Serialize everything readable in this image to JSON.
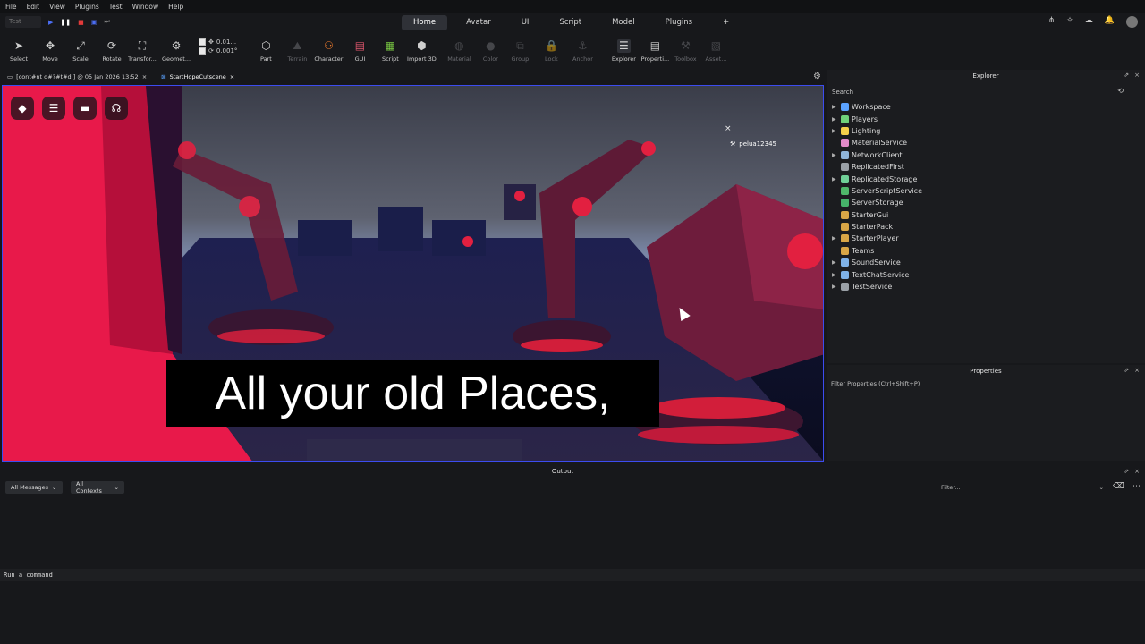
{
  "menu": [
    "File",
    "Edit",
    "View",
    "Plugins",
    "Test",
    "Window",
    "Help"
  ],
  "test_mode": "Test",
  "top_tabs": [
    {
      "label": "Home",
      "active": true
    },
    {
      "label": "Avatar",
      "active": false
    },
    {
      "label": "UI",
      "active": false
    },
    {
      "label": "Script",
      "active": false
    },
    {
      "label": "Model",
      "active": false
    },
    {
      "label": "Plugins",
      "active": false
    }
  ],
  "toolbar": {
    "select": "Select",
    "move": "Move",
    "scale": "Scale",
    "rotate": "Rotate",
    "transform": "Transfor...",
    "geometry": "Geomet...",
    "step_move": "0.01...",
    "step_rotate": "0.001°",
    "part": "Part",
    "terrain": "Terrain",
    "character": "Character",
    "gui": "GUI",
    "script": "Script",
    "import3d": "Import 3D",
    "material": "Material",
    "color": "Color",
    "group": "Group",
    "lock": "Lock",
    "anchor": "Anchor",
    "explorer": "Explorer",
    "properties": "Properti...",
    "toolbox": "Toolbox",
    "assets": "Asset..."
  },
  "doc_tabs": [
    {
      "label": "[cont#nt d#?#t#d ] @ 05 Jan 2026 13:52",
      "active": false
    },
    {
      "label": "StartHopeCutscene",
      "active": true
    }
  ],
  "viewport": {
    "username": "pelua12345",
    "subtitle": "All your old Places,"
  },
  "explorer": {
    "title": "Explorer",
    "search_placeholder": "Search",
    "items": [
      {
        "label": "Workspace",
        "color": "#5aa2ff",
        "expandable": true
      },
      {
        "label": "Players",
        "color": "#6fd17a",
        "expandable": true
      },
      {
        "label": "Lighting",
        "color": "#f5d04a",
        "expandable": true
      },
      {
        "label": "MaterialService",
        "color": "#e28ac8",
        "expandable": false
      },
      {
        "label": "NetworkClient",
        "color": "#8fb4d9",
        "expandable": true
      },
      {
        "label": "ReplicatedFirst",
        "color": "#9aa0a6",
        "expandable": false
      },
      {
        "label": "ReplicatedStorage",
        "color": "#6fcf97",
        "expandable": true
      },
      {
        "label": "ServerScriptService",
        "color": "#4fb86a",
        "expandable": false
      },
      {
        "label": "ServerStorage",
        "color": "#46b46a",
        "expandable": false
      },
      {
        "label": "StarterGui",
        "color": "#d9a646",
        "expandable": false
      },
      {
        "label": "StarterPack",
        "color": "#d9a646",
        "expandable": false
      },
      {
        "label": "StarterPlayer",
        "color": "#d9a646",
        "expandable": true
      },
      {
        "label": "Teams",
        "color": "#d9a646",
        "expandable": false
      },
      {
        "label": "SoundService",
        "color": "#7fb2e8",
        "expandable": true
      },
      {
        "label": "TextChatService",
        "color": "#7fb2e8",
        "expandable": true
      },
      {
        "label": "TestService",
        "color": "#9aa0a6",
        "expandable": true
      }
    ]
  },
  "properties": {
    "title": "Properties",
    "filter_placeholder": "Filter Properties (Ctrl+Shift+P)"
  },
  "output": {
    "title": "Output",
    "messages_filter": "All Messages",
    "contexts_filter": "All Contexts",
    "filter_placeholder": "Filter..."
  },
  "command_bar": {
    "placeholder": "Run a command"
  },
  "colors": {
    "accent": "#3c4cf0",
    "viewport_red": "#e8194a"
  }
}
